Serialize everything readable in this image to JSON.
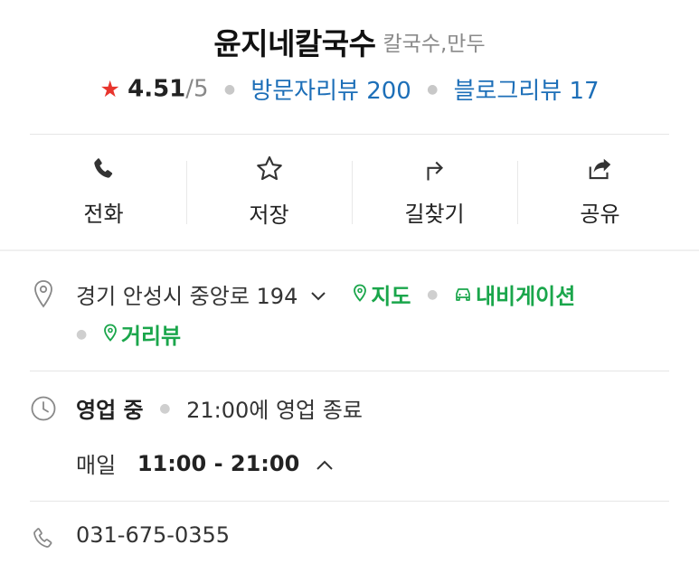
{
  "place": {
    "name": "윤지네칼국수",
    "category": "칼국수,만두",
    "rating": "4.51",
    "rating_max": "/5",
    "visitor_reviews": "방문자리뷰 200",
    "blog_reviews": "블로그리뷰 17"
  },
  "actions": {
    "call": "전화",
    "save": "저장",
    "directions": "길찾기",
    "share": "공유"
  },
  "address": {
    "text": "경기 안성시 중앙로 194",
    "map": "지도",
    "navigation": "내비게이션",
    "street_view": "거리뷰"
  },
  "hours": {
    "status": "영업 중",
    "closing": "21:00에 영업 종료",
    "day": "매일",
    "range": "11:00 - 21:00"
  },
  "phone": {
    "number": "031-675-0355"
  },
  "colors": {
    "accent_blue": "#1d6fb8",
    "accent_green": "#1aa64b",
    "star_red": "#e8352d"
  }
}
